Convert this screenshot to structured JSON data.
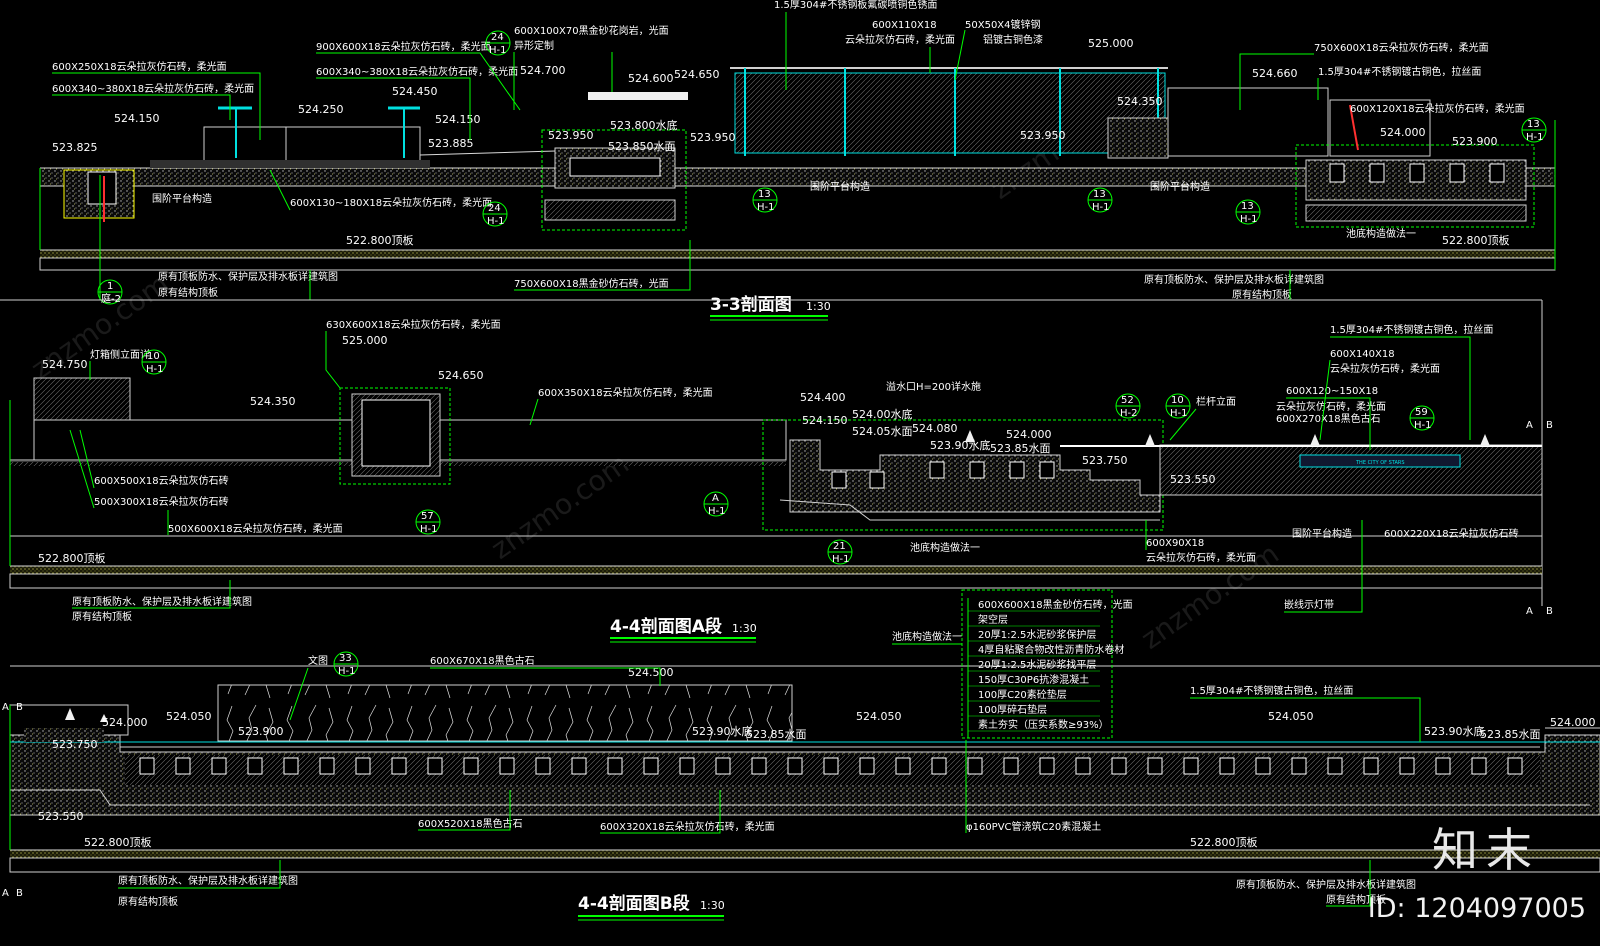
{
  "sections": {
    "s33": {
      "title": "3-3剖面图",
      "scale": "1:30"
    },
    "s44a": {
      "title": "4-4剖面图A段",
      "scale": "1:30"
    },
    "s44b": {
      "title": "4-4剖面图B段",
      "scale": "1:30"
    }
  },
  "s33_labels": {
    "l1": "600X250X18云朵拉灰仿石砖，柔光面",
    "l2": "600X340~380X18云朵拉灰仿石砖，柔光面",
    "l3": "900X600X18云朵拉灰仿石砖，柔光面",
    "l4": "600X340~380X18云朵拉灰仿石砖，柔光面",
    "l5": "600X100X70黑金砂花岗岩，光面",
    "l6": "异形定制",
    "l7": "1.5厚304#不锈钢板氟碳喷铜色锈面",
    "l8": "600X110X18",
    "l9": "云朵拉灰仿石砖，柔光面",
    "l10": "50X50X4镀锌钢",
    "l11": "铝镀古铜色漆",
    "l12": "750X600X18云朵拉灰仿石砖，柔光面",
    "l13": "1.5厚304#不锈钢镀古铜色，拉丝面",
    "l14": "600X120X18云朵拉灰仿石砖，柔光面",
    "l15": "600X130~180X18云朵拉灰仿石砖，柔光面",
    "l16": "围阶平台构造",
    "l17": "围阶平台构造",
    "l18": "围阶平台构造",
    "l19": "池底构造做法一",
    "l20": "原有顶板防水、保护层及排水板详建筑图",
    "l21": "原有结构顶板",
    "l22": "750X600X18黑金砂仿石砖，光面",
    "l23": "原有顶板防水、保护层及排水板详建筑图",
    "l24": "原有结构顶板"
  },
  "s33_elev": {
    "e1": "523.825",
    "e2": "524.150",
    "e3": "524.250",
    "e4": "524.450",
    "e5": "524.150",
    "e6": "523.885",
    "e7": "524.700",
    "e8": "524.600",
    "e9": "524.650",
    "e10": "523.950",
    "e11": "523.800水底",
    "e12": "523.850水面",
    "e13": "523.950",
    "e14": "525.000",
    "e15": "523.950",
    "e16": "524.350",
    "e17": "524.660",
    "e18": "524.000",
    "e19": "523.900",
    "e20": "522.800顶板",
    "e21": "522.800顶板"
  },
  "s33_tags": {
    "t1": "24",
    "t1b": "H-1",
    "t2": "24",
    "t2b": "H-1",
    "t3": "13",
    "t3b": "H-1",
    "t4": "13",
    "t4b": "H-1",
    "t5": "13",
    "t5b": "H-1",
    "t6": "13",
    "t6b": "H-1",
    "t7": "1",
    "t7b": "庭-2"
  },
  "s44a_labels": {
    "l1": "630X600X18云朵拉灰仿石砖，柔光面",
    "l2": "灯箱侧立面详",
    "l3": "600X350X18云朵拉灰仿石砖，柔光面",
    "l4": "600X500X18云朵拉灰仿石砖",
    "l5": "500X300X18云朵拉灰仿石砖",
    "l6": "500X600X18云朵拉灰仿石砖，柔光面",
    "l7": "原有顶板防水、保护层及排水板详建筑图",
    "l8": "原有结构顶板",
    "l9": "溢水口H=200详水施",
    "l10": "1.5厚304#不锈钢镀古铜色，拉丝面",
    "l11": "600X140X18",
    "l12": "云朵拉灰仿石砖，柔光面",
    "l13": "600X120~150X18",
    "l14": "云朵拉灰仿石砖，柔光面",
    "l15": "600X270X18黑色古石",
    "l16": "栏杆立面",
    "l17": "围阶平台构造",
    "l18": "600X220X18云朵拉灰仿石砖",
    "l19": "600X90X18",
    "l20": "云朵拉灰仿石砖，柔光面",
    "l21": "池底构造做法一",
    "l22": "嵌线示灯带"
  },
  "s44a_elev": {
    "e1": "524.750",
    "e2": "525.000",
    "e3": "524.650",
    "e4": "524.350",
    "e5": "524.400",
    "e6": "524.150",
    "e7": "524.00水底",
    "e8": "524.05水面",
    "e9": "524.080",
    "e10": "523.90水底",
    "e11": "523.85水面",
    "e12": "524.000",
    "e13": "523.750",
    "e14": "523.550",
    "e15": "522.800顶板"
  },
  "s44a_tags": {
    "t1": "10",
    "t1b": "H-1",
    "t2": "57",
    "t2b": "H-1",
    "t3": "A",
    "t3b": "H-1",
    "t4": "21",
    "t4b": "H-1",
    "t5": "52",
    "t5b": "H-2",
    "t6": "10",
    "t6b": "H-1",
    "t7": "59",
    "t7b": "H-1"
  },
  "s44a_plaque": "THE CITY OF STARS",
  "legend": {
    "title": "池底构造做法一",
    "items": [
      "600X600X18黑金砂仿石砖，光面",
      "架空层",
      "20厚1:2.5水泥砂浆保护层",
      "4厚自粘聚合物改性沥青防水卷材",
      "20厚1:2.5水泥砂浆找平层",
      "150厚C30P6抗渗混凝土",
      "100厚C20素砼垫层",
      "100厚碎石垫层",
      "素土夯实（压实系数≥93%）"
    ]
  },
  "s44b_labels": {
    "l1": "文图",
    "l2": "600X670X18黑色古石",
    "l3": "1.5厚304#不锈钢镀古铜色，拉丝面",
    "l4": "600X520X18黑色古石",
    "l5": "600X320X18云朵拉灰仿石砖，柔光面",
    "l6": "φ160PVC管浇筑C20素混凝土",
    "l7": "原有顶板防水、保护层及排水板详建筑图",
    "l8": "原有结构顶板",
    "l9": "原有顶板防水、保护层及排水板详建筑图",
    "l10": "原有结构顶板"
  },
  "s44b_elev": {
    "e1": "524.000",
    "e2": "524.050",
    "e3": "523.750",
    "e4": "523.900",
    "e5": "524.500",
    "e6": "523.90水底",
    "e7": "523.85水面",
    "e8": "524.050",
    "e9": "524.050",
    "e10": "523.90水底",
    "e11": "523.85水面",
    "e12": "524.000",
    "e13": "523.550",
    "e14": "522.800顶板",
    "e15": "522.800顶板"
  },
  "s44b_tags": {
    "t1": "33",
    "t1b": "H-1"
  },
  "markers": {
    "a": "A",
    "b": "B"
  },
  "brand": "知末",
  "image_id": "ID: 1204097005",
  "watermark": "znzmo.com"
}
